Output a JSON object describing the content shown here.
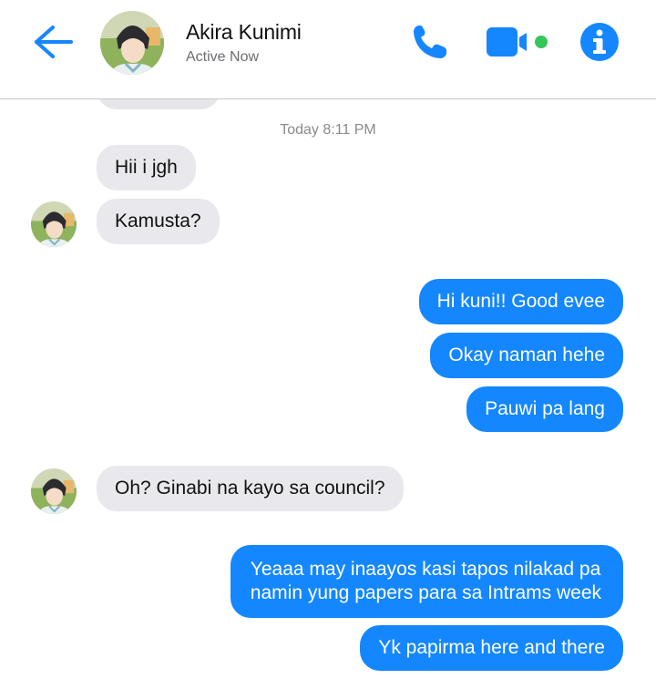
{
  "header": {
    "name": "Akira Kunimi",
    "status": "Active Now",
    "back_icon": "back-arrow-icon",
    "call_icon": "phone-icon",
    "video_icon": "video-camera-icon",
    "info_icon": "info-icon",
    "accent": "#1487fe"
  },
  "timestamp": "Today 8:11 PM",
  "messages": [
    {
      "dir": "in",
      "text": "Hii i jgh"
    },
    {
      "dir": "in",
      "text": "Kamusta?"
    },
    {
      "dir": "out",
      "text": "Hi kuni!! Good evee"
    },
    {
      "dir": "out",
      "text": "Okay naman hehe"
    },
    {
      "dir": "out",
      "text": "Pauwi pa lang"
    },
    {
      "dir": "in",
      "text": "Oh? Ginabi na kayo sa council?"
    },
    {
      "dir": "out",
      "text": "Yeaaa may inaayos kasi tapos nilakad pa"
    },
    {
      "dir": "out",
      "text": "namin yung papers para sa Intrams week"
    },
    {
      "dir": "out",
      "text": "Yk papirma here and there"
    }
  ],
  "colors": {
    "outgoing_bubble": "#1487fe",
    "incoming_bubble": "#e9e9ed",
    "status_gray": "#6d6d72",
    "active_dot": "#34c759"
  }
}
